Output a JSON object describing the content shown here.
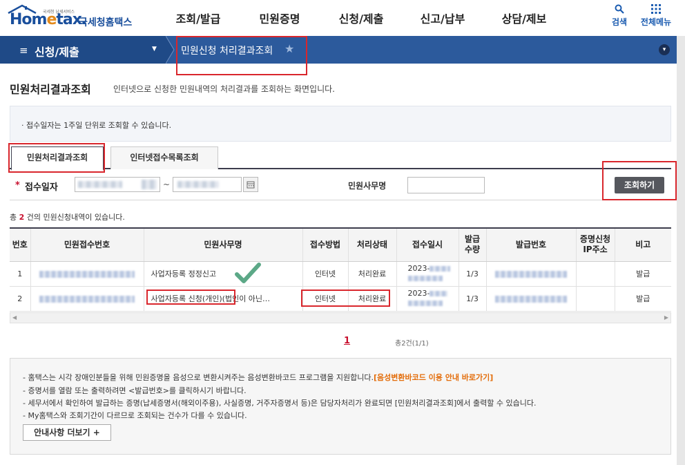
{
  "header": {
    "logo_home": "Hom",
    "logo_e": "e",
    "logo_tax": "tax.",
    "logo_sub": "국세청 납세서비스",
    "logo_kr": "국세청홈택스",
    "gnb": [
      "조회/발급",
      "민원증명",
      "신청/제출",
      "신고/납부",
      "상담/제보"
    ],
    "search_label": "검색",
    "menu_label": "전체메뉴"
  },
  "navbar": {
    "section": "신청/제출",
    "breadcrumb": "민원신청 처리결과조회"
  },
  "page": {
    "title": "민원처리결과조회",
    "description": "인터넷으로 신청한 민원내역의 처리결과를 조회하는 화면입니다.",
    "notice": "· 접수일자는 1주일 단위로 조회할 수 있습니다."
  },
  "tabs": [
    {
      "label": "민원처리결과조회",
      "active": true
    },
    {
      "label": "인터넷접수목록조회",
      "active": false
    }
  ],
  "search": {
    "required_mark": "*",
    "date_label": "접수일자",
    "tilde": "~",
    "office_label": "민원사무명",
    "button": "조회하기"
  },
  "result": {
    "prefix": "총 ",
    "count": "2",
    "suffix": " 건의 민원신청내역이 있습니다."
  },
  "table": {
    "headers": [
      "번호",
      "민원접수번호",
      "민원사무명",
      "접수방법",
      "처리상태",
      "접수일시",
      "발급\n수량",
      "발급번호",
      "증명신청\nIP주소",
      "비고"
    ],
    "rows": [
      {
        "no": "1",
        "office": "사업자등록 정정신고",
        "method": "인터넷",
        "status": "처리완료",
        "date": "2023-",
        "qty": "1/3",
        "note": "발급"
      },
      {
        "no": "2",
        "office": "사업자등록 신청(개인)(법인이 아닌…",
        "method": "인터넷",
        "status": "처리완료",
        "date": "2023-",
        "qty": "1/3",
        "note": "발급"
      }
    ]
  },
  "pager": {
    "current": "1",
    "total": "총2건(1/1)"
  },
  "info": {
    "line1": "- 홈택스는 시각 장애인분들을 위해 민원증명을 음성으로 변환시켜주는 음성변환바코드 프로그램을 지원합니다.",
    "line1_link": "[음성변환바코드 이용 안내 바로가기]",
    "line2": "- 증명서를 열람 또는 출력하려면 <발급번호>를 클릭하시기 바랍니다.",
    "line3": "- 세무서에서 확인하여 발급하는 증명(납세증명서(해외이주용), 사실증명, 거주자증명서 등)은 담당자처리가 완료되면 [민원처리결과조회]에서 출력할 수 있습니다.",
    "line4": "- My홈택스와 조회기간이 다르므로 조회되는 건수가 다를 수 있습니다.",
    "more_button": "안내사항 더보기 +"
  },
  "colors": {
    "brand_blue": "#1a4f9c",
    "navbar": "#2c5a9c",
    "annotation_red": "#d9262c",
    "check_green": "#4a9e7a"
  }
}
